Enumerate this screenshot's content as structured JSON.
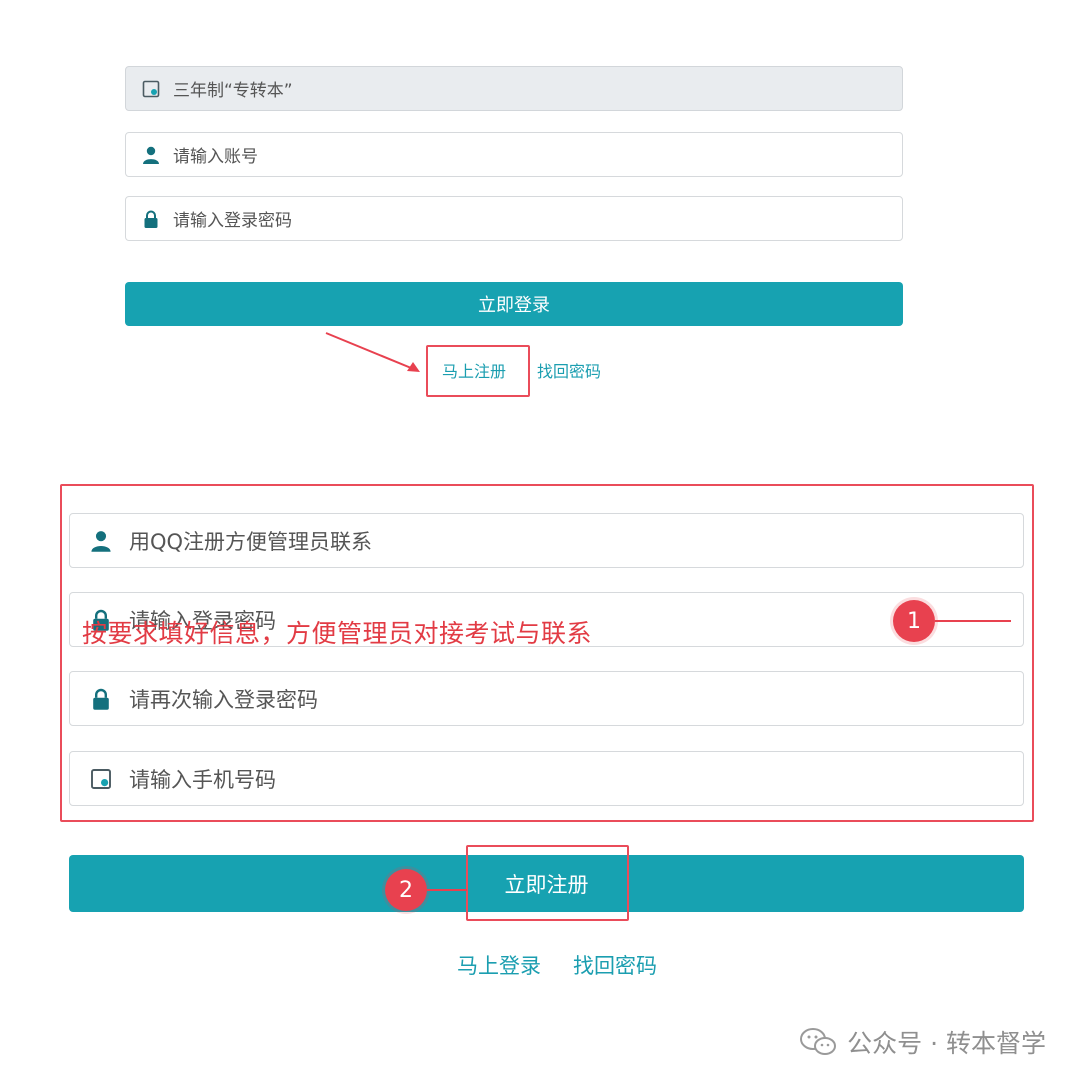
{
  "login_form": {
    "school_type_value": "三年制“专转本”",
    "account_placeholder": "请输入账号",
    "password_placeholder": "请输入登录密码",
    "login_button": "立即登录",
    "register_link": "马上注册",
    "forgot_link": "找回密码"
  },
  "register_form": {
    "qq_placeholder": "用QQ注册方便管理员联系",
    "password_placeholder": "请输入登录密码",
    "confirm_password_placeholder": "请再次输入登录密码",
    "phone_placeholder": "请输入手机号码",
    "register_button": "立即注册",
    "login_link": "马上登录",
    "forgot_link": "找回密码"
  },
  "annotations": {
    "note_text": "按要求填好信息，方便管理员对接考试与联系",
    "badge_1": "1",
    "badge_2": "2",
    "highlight_color": "#e8414f"
  },
  "watermark": {
    "text": "公众号 · 转本督学"
  },
  "theme": {
    "accent": "#17a2b1",
    "link": "#1b9eb0",
    "icon": "#14707d"
  }
}
